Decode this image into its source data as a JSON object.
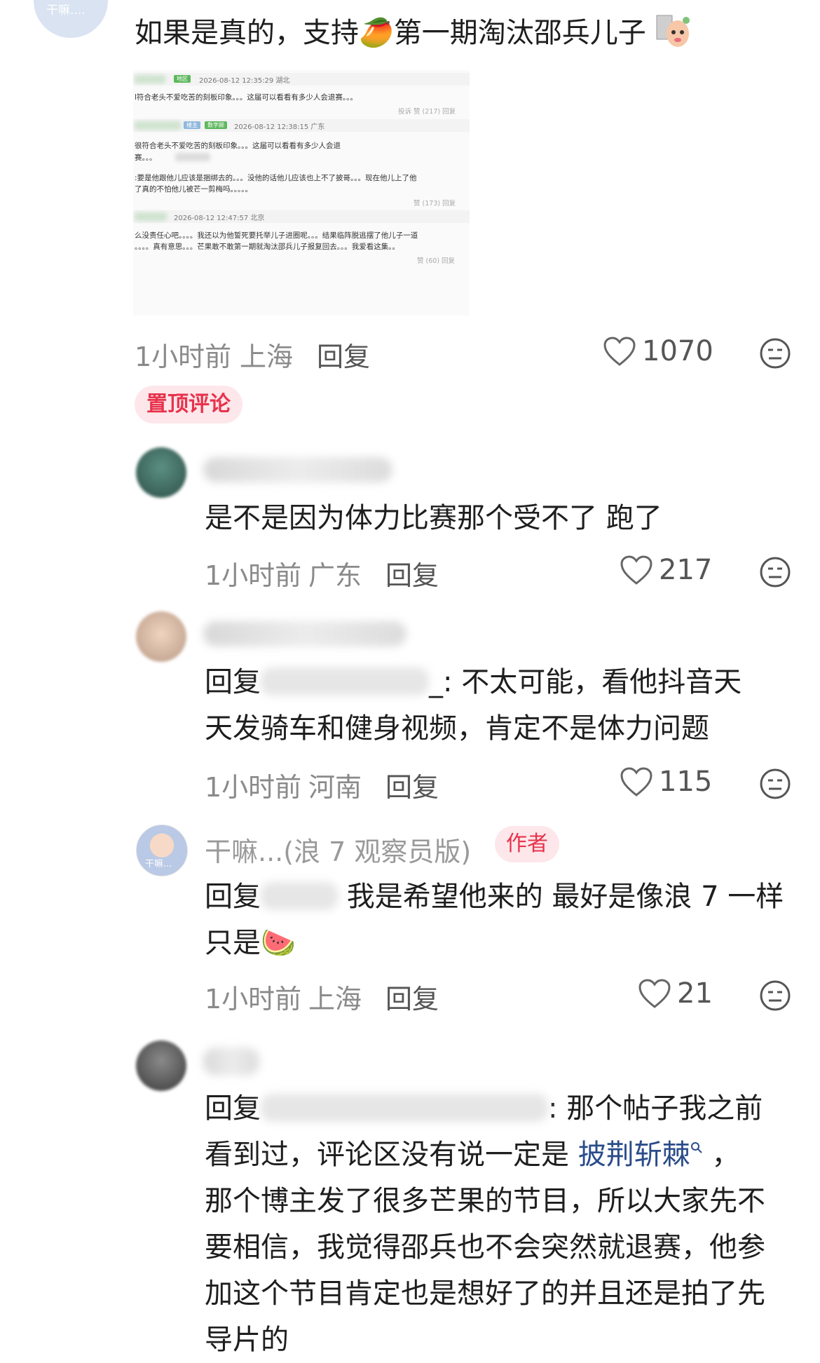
{
  "top_comment": {
    "avatar_text": "干嘛....",
    "text_a": "如果是真的，支持",
    "text_b": "第一期淘汰邵兵儿子",
    "emoji_mango": "🥭",
    "screenshot": {
      "rows": [
        {
          "tag": "地区",
          "date": "2026-08-12 12:35:29 湖北",
          "line1": "l符合老头不爱吃苦的刻板印象。。。这届可以看看有多少人会退赛。。。",
          "line2": "",
          "foot": "投诉  赞 (217)  回复"
        },
        {
          "tag1": "楼主",
          "tag2": "数字顾",
          "date": "2026-08-12 12:38:15 广东",
          "line1": "很符合老头不爱吃苦的刻板印象。。。这届可以看看有多少人会退",
          "line2": "赛。。。",
          "line3": ":要是他跟他儿应该是捆绑去的。。。没他的话他儿应该也上不了披哥。。。现在他儿上了他",
          "line4": "了真的不怕他儿被芒一剪梅吗。。。。。",
          "foot": "赞 (173)  回复"
        },
        {
          "date": "2026-08-12 12:47:57 北京",
          "line1": "么没责任心吧。。。。我还以为他誓死要托举儿子进圈呢。。。结果临阵脱逃摆了他儿子一道",
          "line2": "。。。。真有意思。。。芒果敢不敢第一期就淘汰邵兵儿子报复回去。。。我爱看这集。。",
          "foot": "赞 (60)  回复"
        }
      ]
    },
    "time": "1小时前",
    "location": "上海",
    "reply_label": "回复",
    "likes": "1070",
    "pin_label": "置顶评论"
  },
  "replies": [
    {
      "text": "是不是因为体力比赛那个受不了 跑了",
      "time": "1小时前",
      "location": "广东",
      "reply_label": "回复",
      "likes": "217"
    },
    {
      "prefix": "回复",
      "suffix_line1": "_: 不太可能，看他抖音天",
      "line2": "天发骑车和健身视频，肯定不是体力问题",
      "time": "1小时前",
      "location": "河南",
      "reply_label": "回复",
      "likes": "115"
    },
    {
      "username": "干嘛...(浪 7 观察员版)",
      "author_badge": "作者",
      "avatar_text": "干嘛...",
      "prefix": "回复",
      "suffix_line1": "我是希望他来的 最好是像浪 7 一样",
      "line2": "只是",
      "emoji_watermelon": "🍉",
      "time": "1小时前",
      "location": "上海",
      "reply_label": "回复",
      "likes": "21"
    },
    {
      "prefix": "回复",
      "suffix_line1": ": 那个帖子我之前",
      "line2_a": "看到过，评论区没有说一定是",
      "line2_mention": "披荆斩棘",
      "line2_b": "，",
      "line3": "那个博主发了很多芒果的节目，所以大家先不",
      "line4": "要相信，我觉得邵兵也不会突然就退赛，他参",
      "line5": "加这个节目肯定也是想好了的并且还是拍了先",
      "line6": "导片的"
    }
  ],
  "colors": {
    "accent": "#e8324c",
    "badge_bg": "#fde7ea",
    "mention": "#2a4c8a",
    "meta": "#8a8a8a"
  },
  "icons": [
    "heart-icon",
    "dislike-face-icon",
    "search-icon"
  ]
}
